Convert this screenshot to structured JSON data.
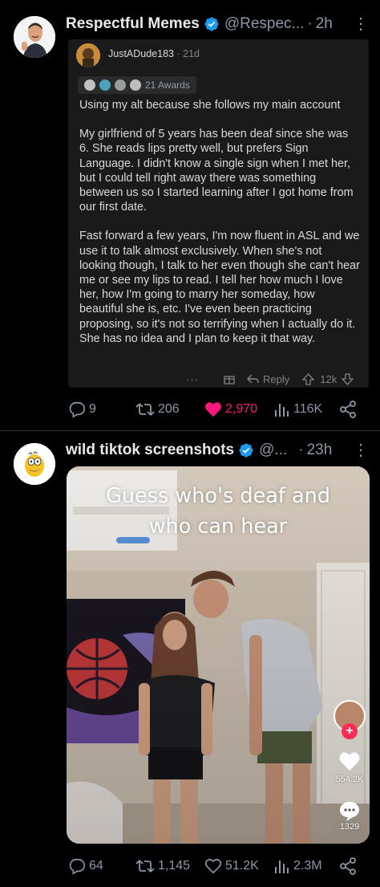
{
  "posts": [
    {
      "author": "Respectful Memes",
      "handle": "@Respec...",
      "time": "2h",
      "more": "⋮",
      "reddit": {
        "username": "JustADude183",
        "time": "21d",
        "awards_label": "21 Awards",
        "paragraphs": [
          "Using my alt because she follows my main account",
          "My girlfriend of 5 years has been deaf since she was 6. She reads lips pretty well, but prefers Sign Language. I didn't know a single sign when I met her, but I could tell right away there was something between us so I started learning after I got home from our first date.",
          "Fast forward a few years, I'm now fluent in ASL and we use it to talk almost exclusively. When she's not looking though, I talk to her even though she can't hear me or see my lips to read. I tell her how much I love her, how I'm going to marry her someday, how beautiful she is, etc. I've even been practicing proposing, so it's not so terrifying when I actually do it. She has no idea and I plan to keep it that way."
        ],
        "dots": "···",
        "reply_label": "Reply",
        "votes": "12k"
      },
      "stats": {
        "replies": "9",
        "reposts": "206",
        "likes": "2,970",
        "views": "116K"
      },
      "like_color": "#f91880"
    },
    {
      "author": "wild tiktok screenshots",
      "handle": "@...",
      "time": "23h",
      "more": "⋮",
      "media": {
        "caption_line1": "Guess who's deaf and",
        "caption_line2": "who can hear",
        "likes": "554.2K",
        "comments": "1329"
      },
      "stats": {
        "replies": "64",
        "reposts": "1,145",
        "likes": "51.2K",
        "views": "2.3M"
      }
    }
  ],
  "colors": {
    "accent": "#1d9bf0",
    "muted": "#8b98a5",
    "like": "#f91880"
  }
}
